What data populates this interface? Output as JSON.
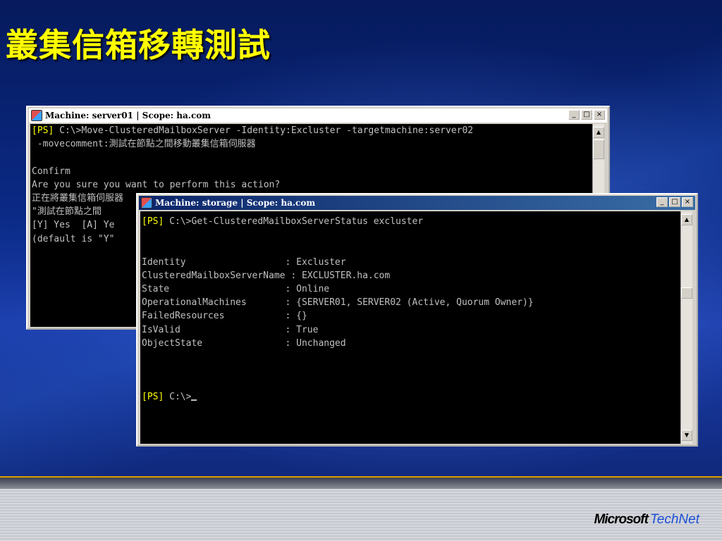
{
  "slide": {
    "title": "叢集信箱移轉測試",
    "logo": {
      "brand": "Microsoft",
      "product": "TechNet"
    }
  },
  "window1": {
    "title": "Machine: server01 | Scope: ha.com",
    "lines": [
      {
        "prompt": "[PS]",
        "text": " C:\\>Move-ClusteredMailboxServer -Identity:Excluster -targetmachine:server02"
      },
      {
        "prompt": "",
        "text": " -movecomment:測試在節點之間移動叢集信箱伺服器"
      },
      {
        "prompt": "",
        "text": ""
      },
      {
        "prompt": "",
        "text": "Confirm"
      },
      {
        "prompt": "",
        "text": "Are you sure you want to perform this action?"
      },
      {
        "prompt": "",
        "text": "正在將叢集信箱伺服器"
      },
      {
        "prompt": "",
        "text": "\"測試在節點之間"
      },
      {
        "prompt": "",
        "text": "[Y] Yes  [A] Ye"
      },
      {
        "prompt": "",
        "text": "(default is \"Y\""
      }
    ]
  },
  "window2": {
    "title": "Machine: storage | Scope: ha.com",
    "lines": [
      {
        "prompt": "[PS]",
        "text": " C:\\>Get-ClusteredMailboxServerStatus excluster"
      },
      {
        "prompt": "",
        "text": ""
      },
      {
        "prompt": "",
        "text": ""
      },
      {
        "prompt": "",
        "text": "Identity                  : Excluster"
      },
      {
        "prompt": "",
        "text": "ClusteredMailboxServerName : EXCLUSTER.ha.com"
      },
      {
        "prompt": "",
        "text": "State                     : Online"
      },
      {
        "prompt": "",
        "text": "OperationalMachines       : {SERVER01, SERVER02 (Active, Quorum Owner)}"
      },
      {
        "prompt": "",
        "text": "FailedResources           : {}"
      },
      {
        "prompt": "",
        "text": "IsValid                   : True"
      },
      {
        "prompt": "",
        "text": "ObjectState               : Unchanged"
      },
      {
        "prompt": "",
        "text": ""
      },
      {
        "prompt": "",
        "text": ""
      },
      {
        "prompt": "",
        "text": ""
      },
      {
        "prompt": "[PS]",
        "text": " C:\\>"
      }
    ]
  },
  "controls": {
    "minimize": "_",
    "maximize": "□",
    "close": "×"
  },
  "icons": {
    "app": "powershell-icon",
    "scroll_up": "▲",
    "scroll_down": "▼"
  }
}
